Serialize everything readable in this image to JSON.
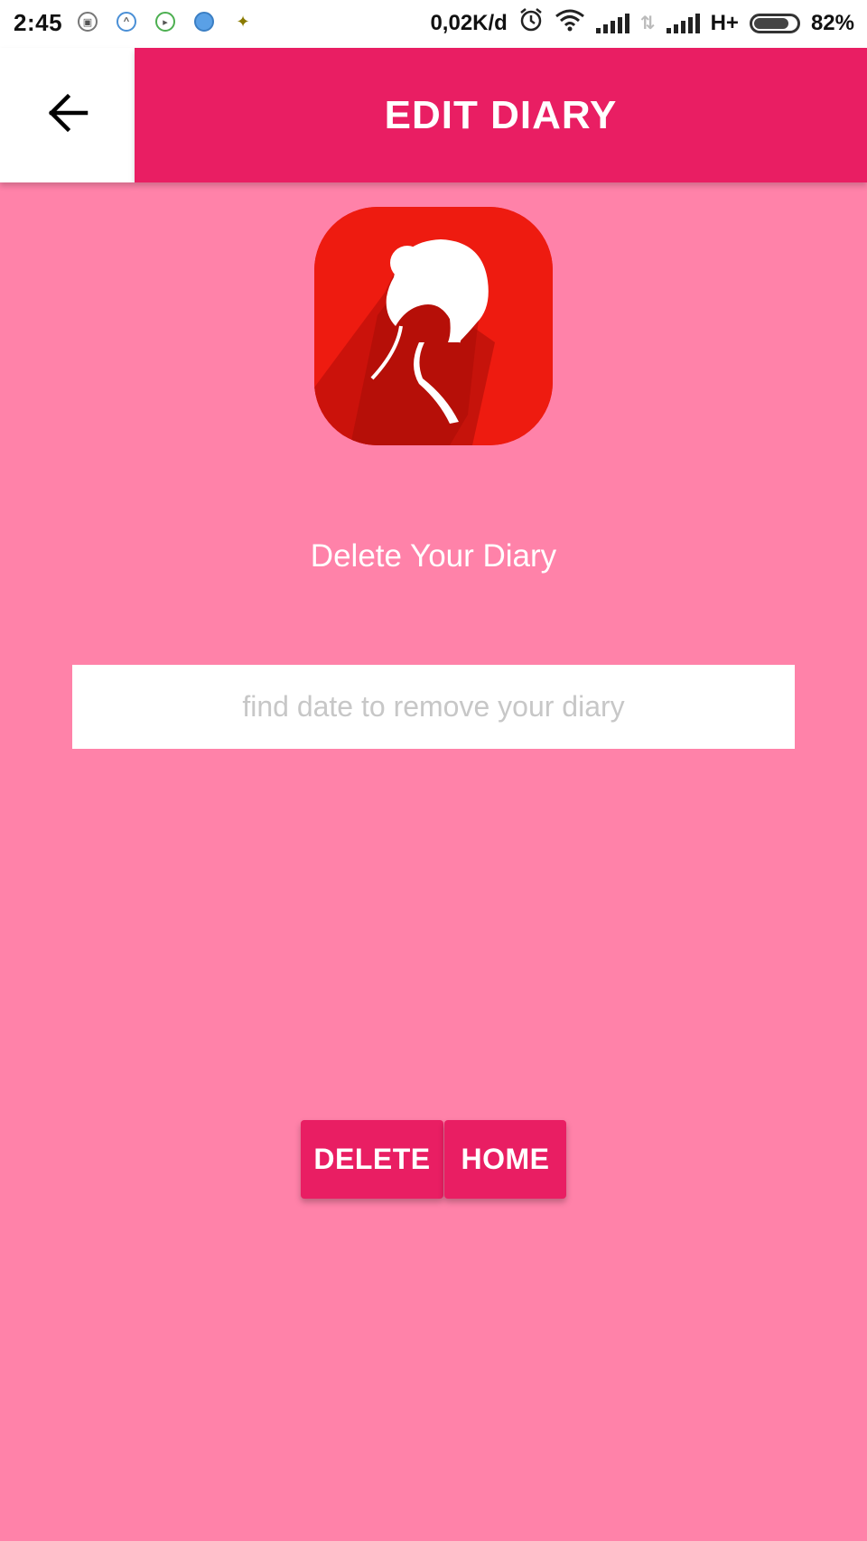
{
  "status_bar": {
    "time": "2:45",
    "speed": "0,02K/d",
    "network_type": "H+",
    "battery_percent": "82%",
    "battery_level": 0.82,
    "icons": [
      "notification-app-icon",
      "notification-arrow-icon",
      "notification-play-icon",
      "notification-circle-icon",
      "notification-star-icon",
      "alarm-icon",
      "wifi-icon",
      "signal-icon",
      "data-arrows-icon",
      "signal-icon"
    ]
  },
  "app_bar": {
    "back_icon": "arrow-left-icon",
    "title": "EDIT DIARY"
  },
  "main": {
    "logo_icon": "woman-silhouette-logo",
    "subtitle": "Delete Your Diary",
    "date_input": {
      "value": "",
      "placeholder": "find date to remove your diary"
    },
    "buttons": {
      "delete": "DELETE",
      "home": "HOME"
    }
  },
  "colors": {
    "background": "#ff82a9",
    "accent": "#e91e63",
    "logo": "#e8160e"
  }
}
